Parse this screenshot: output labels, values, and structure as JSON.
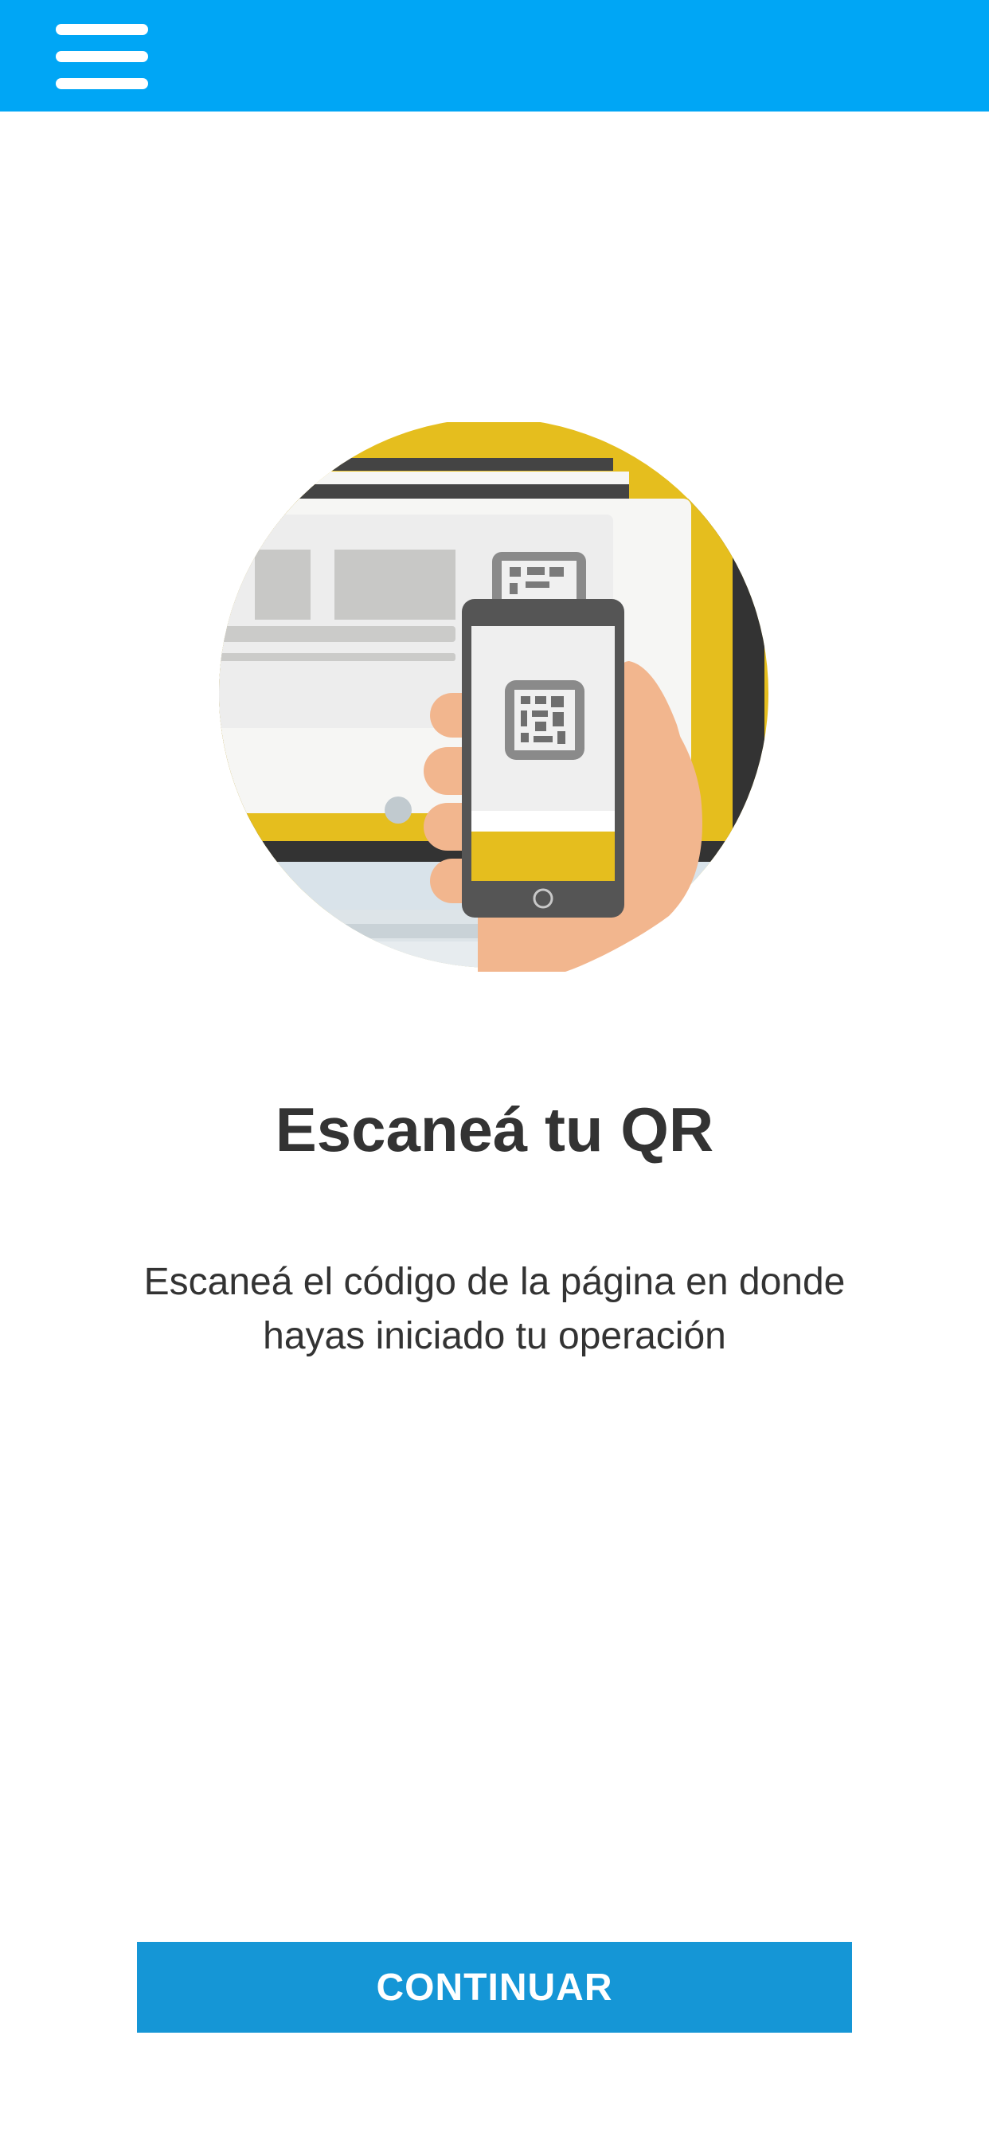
{
  "header": {
    "menu_icon": "hamburger-menu-icon",
    "background_color": "#00A6F5"
  },
  "main": {
    "illustration": "qr-scan-illustration",
    "title": "Escaneá tu QR",
    "description": "Escaneá el código de la página en donde hayas iniciado tu operación"
  },
  "footer": {
    "continue_label": "CONTINUAR",
    "button_color": "#1596D6"
  },
  "colors": {
    "accent_yellow": "#E5BE1E",
    "dark_gray": "#3A3A3A",
    "skin": "#F2B68E"
  }
}
